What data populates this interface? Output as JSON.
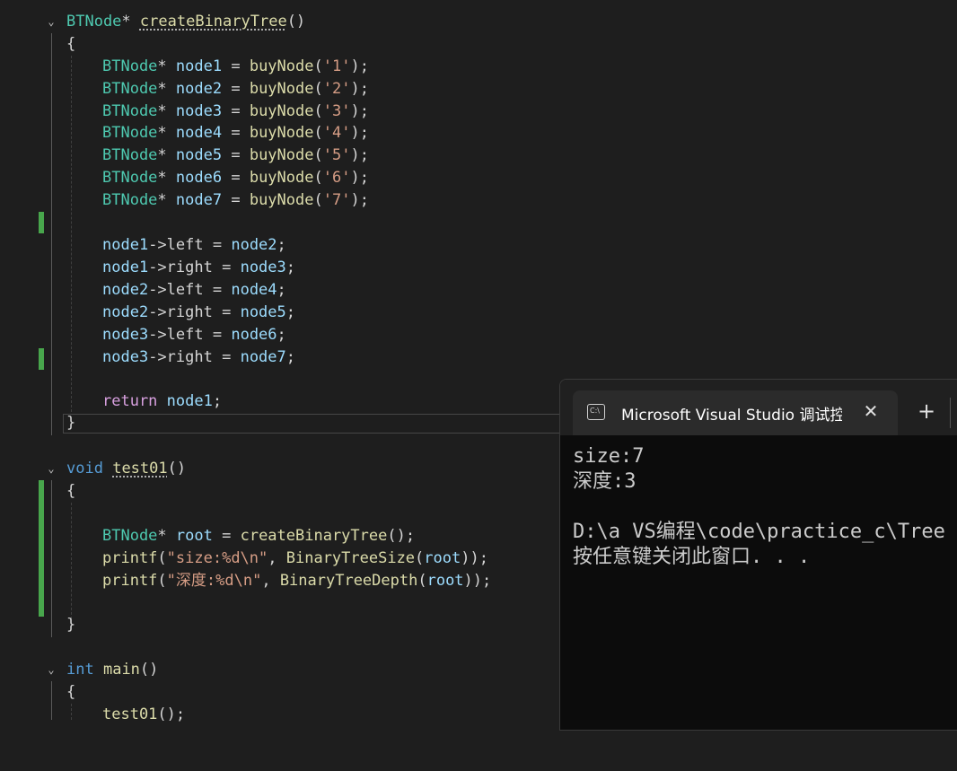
{
  "editor": {
    "func1": {
      "ret_type": "BTNode",
      "star": "*",
      "name": "createBinaryTree",
      "parens": "()",
      "open_brace": "{",
      "decls": [
        {
          "type": "BTNode",
          "star": "*",
          "var": "node1",
          "eq": " = ",
          "call": "buyNode",
          "arg_open": "(",
          "arg": "'1'",
          "arg_close": ")",
          "semi": ";"
        },
        {
          "type": "BTNode",
          "star": "*",
          "var": "node2",
          "eq": " = ",
          "call": "buyNode",
          "arg_open": "(",
          "arg": "'2'",
          "arg_close": ")",
          "semi": ";"
        },
        {
          "type": "BTNode",
          "star": "*",
          "var": "node3",
          "eq": " = ",
          "call": "buyNode",
          "arg_open": "(",
          "arg": "'3'",
          "arg_close": ")",
          "semi": ";"
        },
        {
          "type": "BTNode",
          "star": "*",
          "var": "node4",
          "eq": " = ",
          "call": "buyNode",
          "arg_open": "(",
          "arg": "'4'",
          "arg_close": ")",
          "semi": ";"
        },
        {
          "type": "BTNode",
          "star": "*",
          "var": "node5",
          "eq": " = ",
          "call": "buyNode",
          "arg_open": "(",
          "arg": "'5'",
          "arg_close": ")",
          "semi": ";"
        },
        {
          "type": "BTNode",
          "star": "*",
          "var": "node6",
          "eq": " = ",
          "call": "buyNode",
          "arg_open": "(",
          "arg": "'6'",
          "arg_close": ")",
          "semi": ";"
        },
        {
          "type": "BTNode",
          "star": "*",
          "var": "node7",
          "eq": " = ",
          "call": "buyNode",
          "arg_open": "(",
          "arg": "'7'",
          "arg_close": ")",
          "semi": ";"
        }
      ],
      "links": [
        {
          "obj": "node1",
          "arrow": "->",
          "field": "left",
          "eq": " = ",
          "val": "node2",
          "semi": ";"
        },
        {
          "obj": "node1",
          "arrow": "->",
          "field": "right",
          "eq": " = ",
          "val": "node3",
          "semi": ";"
        },
        {
          "obj": "node2",
          "arrow": "->",
          "field": "left",
          "eq": " = ",
          "val": "node4",
          "semi": ";"
        },
        {
          "obj": "node2",
          "arrow": "->",
          "field": "right",
          "eq": " = ",
          "val": "node5",
          "semi": ";"
        },
        {
          "obj": "node3",
          "arrow": "->",
          "field": "left",
          "eq": " = ",
          "val": "node6",
          "semi": ";"
        },
        {
          "obj": "node3",
          "arrow": "->",
          "field": "right",
          "eq": " = ",
          "val": "node7",
          "semi": ";"
        }
      ],
      "return_kw": "return",
      "return_val": "node1",
      "semi": ";",
      "close_brace": "}"
    },
    "func2": {
      "ret_type": "void",
      "name": "test01",
      "parens": "()",
      "open_brace": "{",
      "root_type": "BTNode",
      "root_star": "*",
      "root_var": "root",
      "root_eq": " = ",
      "root_call": "createBinaryTree",
      "root_parens": "()",
      "root_semi": ";",
      "printf1": {
        "fn": "printf",
        "open": "(",
        "str": "\"size:%d\\n\"",
        "comma": ", ",
        "call": "BinaryTreeSize",
        "copen": "(",
        "arg": "root",
        "cclose": "));"
      },
      "printf2": {
        "fn": "printf",
        "open": "(",
        "str": "\"深度:%d\\n\"",
        "comma": ", ",
        "call": "BinaryTreeDepth",
        "copen": "(",
        "arg": "root",
        "cclose": "));"
      },
      "close_brace": "}"
    },
    "func3": {
      "ret_type": "int",
      "name": "main",
      "parens": "()",
      "open_brace": "{",
      "call": "test01",
      "call_tail": "();"
    },
    "fold_glyph": "⌄"
  },
  "console": {
    "icon_text": "C:\\",
    "title": "Microsoft Visual Studio 调试控制台",
    "close_glyph": "✕",
    "new_tab_glyph": "+",
    "lines": [
      "size:7",
      "深度:3",
      "",
      "D:\\a VS编程\\code\\practice_c\\Tree",
      "按任意键关闭此窗口. . ."
    ]
  },
  "colors": {
    "editor_bg": "#1e1e1e",
    "type": "#4ec9b0",
    "keyword": "#569cd6",
    "control_keyword": "#d8a0df",
    "function": "#dcdcaa",
    "variable": "#9cdcfe",
    "string": "#d69d85",
    "change_bar": "#48a64c",
    "console_bg": "#0c0c0c"
  }
}
